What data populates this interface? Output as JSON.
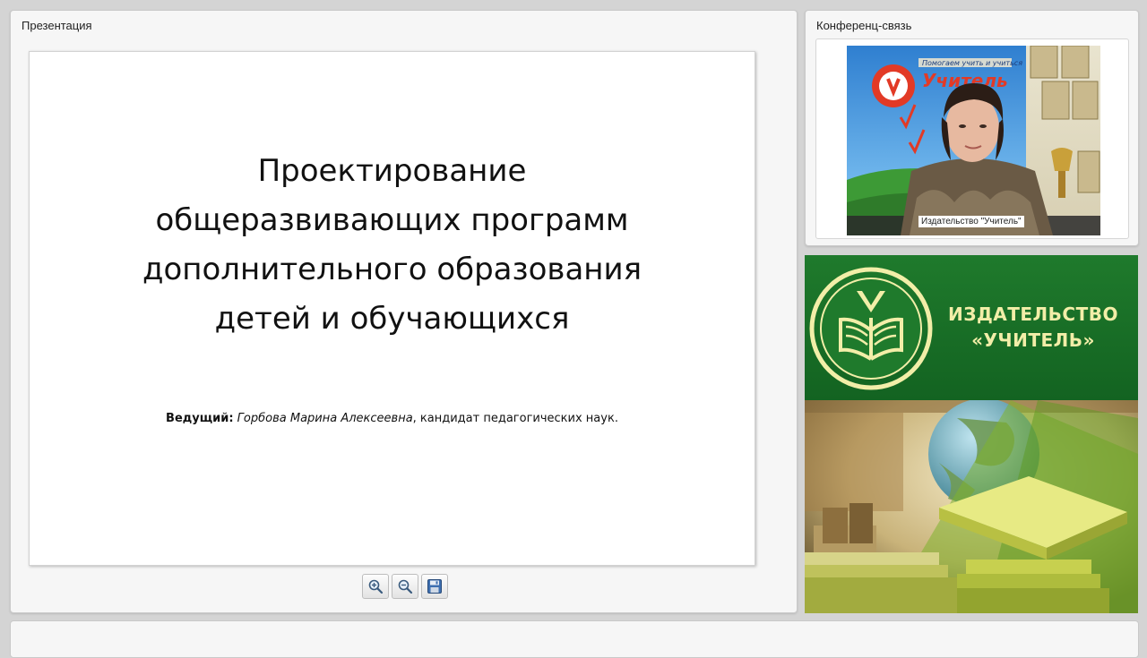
{
  "presentation": {
    "title": "Презентация",
    "slide": {
      "title_lines": [
        "Проектирование",
        "общеразвивающих программ",
        "дополнительного образования",
        "детей и обучающихся"
      ],
      "presenter_label": "Ведущий:",
      "presenter_name": "Горбова Марина Алексеевна",
      "presenter_suffix": ", кандидат педагогических наук."
    },
    "toolbar": {
      "zoom_in_icon": "zoom-in-icon",
      "zoom_out_icon": "zoom-out-icon",
      "save_icon": "save-icon"
    }
  },
  "conference": {
    "title": "Конференц-связь",
    "video": {
      "banner_slogan": "Помогаем учить и учиться",
      "banner_brand": "Учитель",
      "participant_label": "Издательство \"Учитель\""
    }
  },
  "banner": {
    "line1": "ИЗДАТЕЛЬСТВО",
    "line2": "«УЧИТЕЛЬ»"
  },
  "colors": {
    "banner_green": "#1f7a2c",
    "banner_text": "#f2eea8",
    "panel_bg": "#f6f6f6",
    "page_bg": "#d4d4d4"
  }
}
